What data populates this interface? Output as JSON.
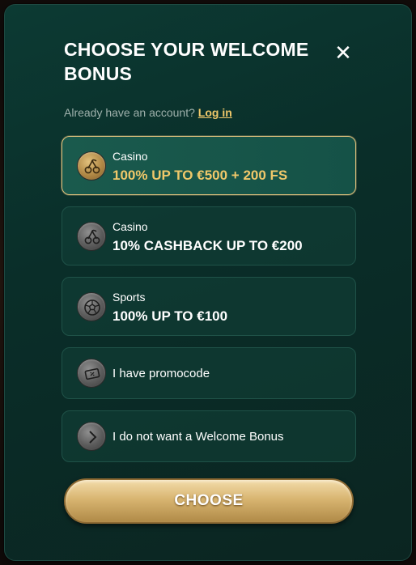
{
  "modal": {
    "title": "CHOOSE YOUR WELCOME BONUS",
    "close_symbol": "✕"
  },
  "account": {
    "prompt": "Already have an account?",
    "login_label": "Log in"
  },
  "options": [
    {
      "category": "Casino",
      "offer": "100% UP TO €500 + 200 FS",
      "icon": "cherry-icon",
      "selected": true
    },
    {
      "category": "Casino",
      "offer": "10% CASHBACK UP TO €200",
      "icon": "cherry-icon",
      "selected": false
    },
    {
      "category": "Sports",
      "offer": "100% UP TO €100",
      "icon": "soccer-ball-icon",
      "selected": false
    },
    {
      "label": "I have promocode",
      "icon": "ticket-percent-icon",
      "selected": false
    },
    {
      "label": "I do not want a Welcome Bonus",
      "icon": "chevron-right-icon",
      "selected": false
    }
  ],
  "choose_button": "CHOOSE",
  "colors": {
    "accent_gold": "#f0c86a",
    "modal_bg": "#0a2e29",
    "selected_border": "#e3c37e"
  }
}
